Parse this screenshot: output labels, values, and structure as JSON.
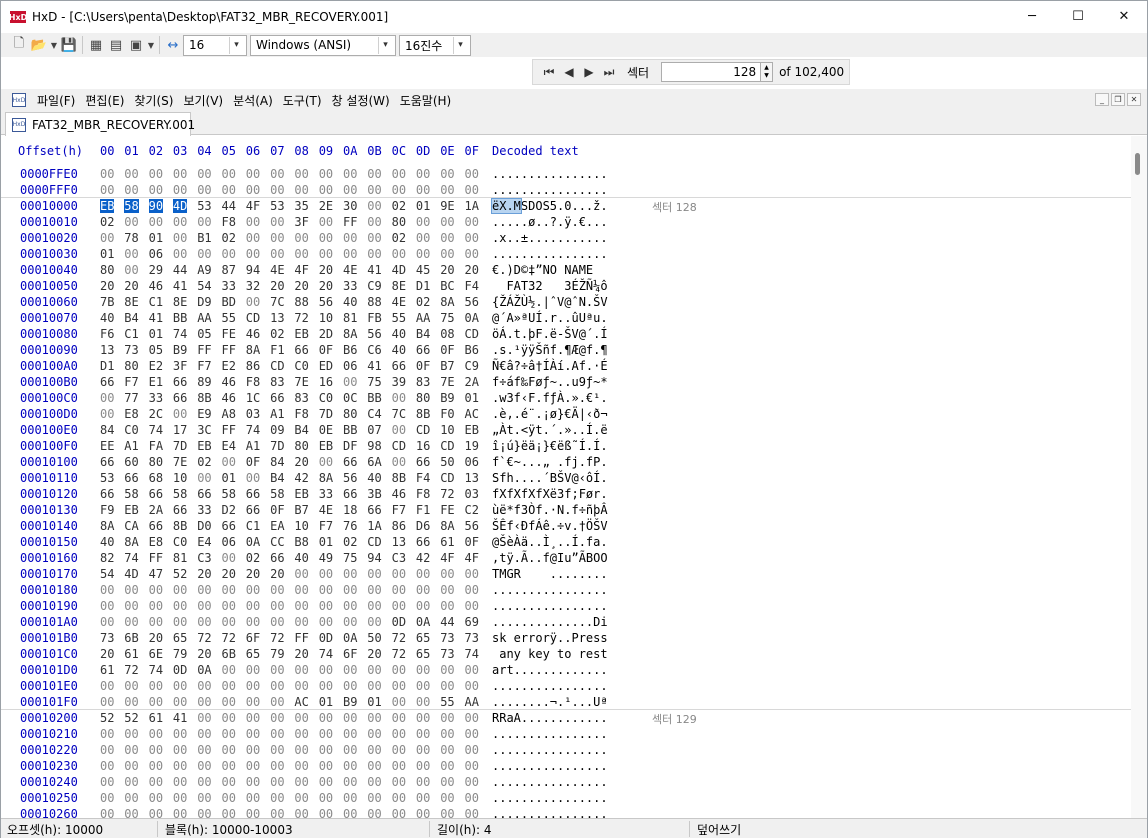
{
  "window": {
    "title": "HxD - [C:\\Users\\penta\\Desktop\\FAT32_MBR_RECOVERY.001]",
    "app_icon_text": "HxD"
  },
  "toolbar": {
    "bytes_per_row": "16",
    "charset": "Windows (ANSI)",
    "offset_base": "16진수"
  },
  "sector_nav": {
    "label": "섹터",
    "value": "128",
    "total": "of 102,400"
  },
  "menu": [
    "파일(F)",
    "편집(E)",
    "찾기(S)",
    "보기(V)",
    "분석(A)",
    "도구(T)",
    "창 설정(W)",
    "도움말(H)"
  ],
  "tab": {
    "label": "FAT32_MBR_RECOVERY.001"
  },
  "hex_header": {
    "offset": "Offset(h)",
    "columns": [
      "00",
      "01",
      "02",
      "03",
      "04",
      "05",
      "06",
      "07",
      "08",
      "09",
      "0A",
      "0B",
      "0C",
      "0D",
      "0E",
      "0F"
    ],
    "decoded": "Decoded text"
  },
  "rows": [
    {
      "offset": "0000FFE0",
      "bytes": "00 00 00 00 00 00 00 00 00 00 00 00 00 00 00 00",
      "text": "................"
    },
    {
      "offset": "0000FFF0",
      "bytes": "00 00 00 00 00 00 00 00 00 00 00 00 00 00 00 00",
      "text": "................"
    },
    {
      "offset": "00010000",
      "bytes": "EB 58 90 4D 53 44 4F 53 35 2E 30 00 02 01 9E 1A",
      "text": "ëX.MSDOS5.0...ž.",
      "sector": "섹터 128"
    },
    {
      "offset": "00010010",
      "bytes": "02 00 00 00 00 F8 00 00 3F 00 FF 00 80 00 00 00",
      "text": ".....ø..?.ÿ.€..."
    },
    {
      "offset": "00010020",
      "bytes": "00 78 01 00 B1 02 00 00 00 00 00 00 02 00 00 00",
      "text": ".x..±..........."
    },
    {
      "offset": "00010030",
      "bytes": "01 00 06 00 00 00 00 00 00 00 00 00 00 00 00 00",
      "text": "................"
    },
    {
      "offset": "00010040",
      "bytes": "80 00 29 44 A9 87 94 4E 4F 20 4E 41 4D 45 20 20",
      "text": "€.)D©‡”NO NAME  "
    },
    {
      "offset": "00010050",
      "bytes": "20 20 46 41 54 33 32 20 20 20 33 C9 8E D1 BC F4",
      "text": "  FAT32   3ÉŽÑ¼ô"
    },
    {
      "offset": "00010060",
      "bytes": "7B 8E C1 8E D9 BD 00 7C 88 56 40 88 4E 02 8A 56",
      "text": "{ŽÁŽÙ½.|ˆV@ˆN.ŠV"
    },
    {
      "offset": "00010070",
      "bytes": "40 B4 41 BB AA 55 CD 13 72 10 81 FB 55 AA 75 0A",
      "text": "@´A»ªUÍ.r..ûUªu."
    },
    {
      "offset": "00010080",
      "bytes": "F6 C1 01 74 05 FE 46 02 EB 2D 8A 56 40 B4 08 CD",
      "text": "öÁ.t.þF.ë-ŠV@´.Í"
    },
    {
      "offset": "00010090",
      "bytes": "13 73 05 B9 FF FF 8A F1 66 0F B6 C6 40 66 0F B6",
      "text": ".s.¹ÿÿŠñf.¶Æ@f.¶"
    },
    {
      "offset": "000100A0",
      "bytes": "D1 80 E2 3F F7 E2 86 CD C0 ED 06 41 66 0F B7 C9",
      "text": "Ñ€â?÷â†ÍÀí.Af.·É"
    },
    {
      "offset": "000100B0",
      "bytes": "66 F7 E1 66 89 46 F8 83 7E 16 00 75 39 83 7E 2A",
      "text": "f÷áf‰Føƒ~..u9ƒ~*"
    },
    {
      "offset": "000100C0",
      "bytes": "00 77 33 66 8B 46 1C 66 83 C0 0C BB 00 80 B9 01",
      "text": ".w3f‹F.fƒÀ.».€¹."
    },
    {
      "offset": "000100D0",
      "bytes": "00 E8 2C 00 E9 A8 03 A1 F8 7D 80 C4 7C 8B F0 AC",
      "text": ".è,.é¨.¡ø}€Ä|‹ð¬"
    },
    {
      "offset": "000100E0",
      "bytes": "84 C0 74 17 3C FF 74 09 B4 0E BB 07 00 CD 10 EB",
      "text": "„Àt.<ÿt.´.»..Í.ë"
    },
    {
      "offset": "000100F0",
      "bytes": "EE A1 FA 7D EB E4 A1 7D 80 EB DF 98 CD 16 CD 19",
      "text": "î¡ú}ëä¡}€ëß˜Í.Í."
    },
    {
      "offset": "00010100",
      "bytes": "66 60 80 7E 02 00 0F 84 20 00 66 6A 00 66 50 06",
      "text": "f`€~...„ .fj.fP."
    },
    {
      "offset": "00010110",
      "bytes": "53 66 68 10 00 01 00 B4 42 8A 56 40 8B F4 CD 13",
      "text": "Sfh....´BŠV@‹ôÍ."
    },
    {
      "offset": "00010120",
      "bytes": "66 58 66 58 66 58 66 58 EB 33 66 3B 46 F8 72 03",
      "text": "fXfXfXfXë3f;Før."
    },
    {
      "offset": "00010130",
      "bytes": "F9 EB 2A 66 33 D2 66 0F B7 4E 18 66 F7 F1 FE C2",
      "text": "ùë*f3Òf.·N.f÷ñþÂ"
    },
    {
      "offset": "00010140",
      "bytes": "8A CA 66 8B D0 66 C1 EA 10 F7 76 1A 86 D6 8A 56",
      "text": "ŠÊf‹ÐfÁê.÷v.†ÖŠV"
    },
    {
      "offset": "00010150",
      "bytes": "40 8A E8 C0 E4 06 0A CC B8 01 02 CD 13 66 61 0F",
      "text": "@ŠèÀä..Ì¸..Í.fa."
    },
    {
      "offset": "00010160",
      "bytes": "82 74 FF 81 C3 00 02 66 40 49 75 94 C3 42 4F 4F",
      "text": "‚tÿ.Ã..f@Iu”ÃBOO"
    },
    {
      "offset": "00010170",
      "bytes": "54 4D 47 52 20 20 20 20 00 00 00 00 00 00 00 00",
      "text": "TMGR    ........"
    },
    {
      "offset": "00010180",
      "bytes": "00 00 00 00 00 00 00 00 00 00 00 00 00 00 00 00",
      "text": "................"
    },
    {
      "offset": "00010190",
      "bytes": "00 00 00 00 00 00 00 00 00 00 00 00 00 00 00 00",
      "text": "................"
    },
    {
      "offset": "000101A0",
      "bytes": "00 00 00 00 00 00 00 00 00 00 00 00 0D 0A 44 69",
      "text": "..............Di"
    },
    {
      "offset": "000101B0",
      "bytes": "73 6B 20 65 72 72 6F 72 FF 0D 0A 50 72 65 73 73",
      "text": "sk errorÿ..Press"
    },
    {
      "offset": "000101C0",
      "bytes": "20 61 6E 79 20 6B 65 79 20 74 6F 20 72 65 73 74",
      "text": " any key to rest"
    },
    {
      "offset": "000101D0",
      "bytes": "61 72 74 0D 0A 00 00 00 00 00 00 00 00 00 00 00",
      "text": "art............."
    },
    {
      "offset": "000101E0",
      "bytes": "00 00 00 00 00 00 00 00 00 00 00 00 00 00 00 00",
      "text": "................"
    },
    {
      "offset": "000101F0",
      "bytes": "00 00 00 00 00 00 00 00 AC 01 B9 01 00 00 55 AA",
      "text": "........¬.¹...Uª"
    },
    {
      "offset": "00010200",
      "bytes": "52 52 61 41 00 00 00 00 00 00 00 00 00 00 00 00",
      "text": "RRaA............",
      "sector": "섹터 129"
    },
    {
      "offset": "00010210",
      "bytes": "00 00 00 00 00 00 00 00 00 00 00 00 00 00 00 00",
      "text": "................"
    },
    {
      "offset": "00010220",
      "bytes": "00 00 00 00 00 00 00 00 00 00 00 00 00 00 00 00",
      "text": "................"
    },
    {
      "offset": "00010230",
      "bytes": "00 00 00 00 00 00 00 00 00 00 00 00 00 00 00 00",
      "text": "................"
    },
    {
      "offset": "00010240",
      "bytes": "00 00 00 00 00 00 00 00 00 00 00 00 00 00 00 00",
      "text": "................"
    },
    {
      "offset": "00010250",
      "bytes": "00 00 00 00 00 00 00 00 00 00 00 00 00 00 00 00",
      "text": "................"
    },
    {
      "offset": "00010260",
      "bytes": "00 00 00 00 00 00 00 00 00 00 00 00 00 00 00 00",
      "text": "................"
    }
  ],
  "selection": {
    "row_offset": "00010000",
    "bytes": 4
  },
  "status": {
    "offset": "오프셋(h): 10000",
    "block": "블록(h): 10000-10003",
    "length": "길이(h): 4",
    "mode": "덮어쓰기"
  },
  "colors": {
    "offset": "#0000c0",
    "selection": "#0a60c9",
    "zero_byte": "#8a8a8a"
  }
}
